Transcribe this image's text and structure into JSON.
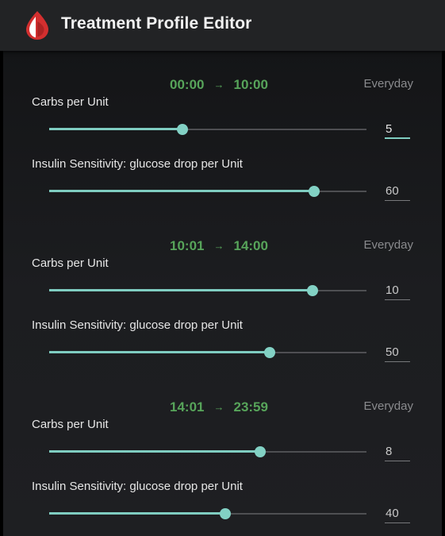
{
  "app": {
    "title": "Treatment Profile Editor",
    "logo_icon": "blood-drop-icon",
    "accent_color": "#7fcdc1",
    "time_color": "#57a45a",
    "logo_color": "#d32f2f"
  },
  "blocks": [
    {
      "start": "00:00",
      "arrow": "→",
      "end": "10:00",
      "days": "Everyday",
      "carbs": {
        "label": "Carbs per Unit",
        "value": "5",
        "level": 0.42,
        "focused": true
      },
      "sensitivity": {
        "label": "Insulin Sensitivity: glucose drop per Unit",
        "value": "60",
        "level": 0.835,
        "focused": false
      }
    },
    {
      "start": "10:01",
      "arrow": "→",
      "end": "14:00",
      "days": "Everyday",
      "carbs": {
        "label": "Carbs per Unit",
        "value": "10",
        "level": 0.83,
        "focused": false
      },
      "sensitivity": {
        "label": "Insulin Sensitivity: glucose drop per Unit",
        "value": "50",
        "level": 0.695,
        "focused": false
      }
    },
    {
      "start": "14:01",
      "arrow": "→",
      "end": "23:59",
      "days": "Everyday",
      "carbs": {
        "label": "Carbs per Unit",
        "value": "8",
        "level": 0.665,
        "focused": false
      },
      "sensitivity": {
        "label": "Insulin Sensitivity: glucose drop per Unit",
        "value": "40",
        "level": 0.555,
        "focused": false
      }
    }
  ]
}
